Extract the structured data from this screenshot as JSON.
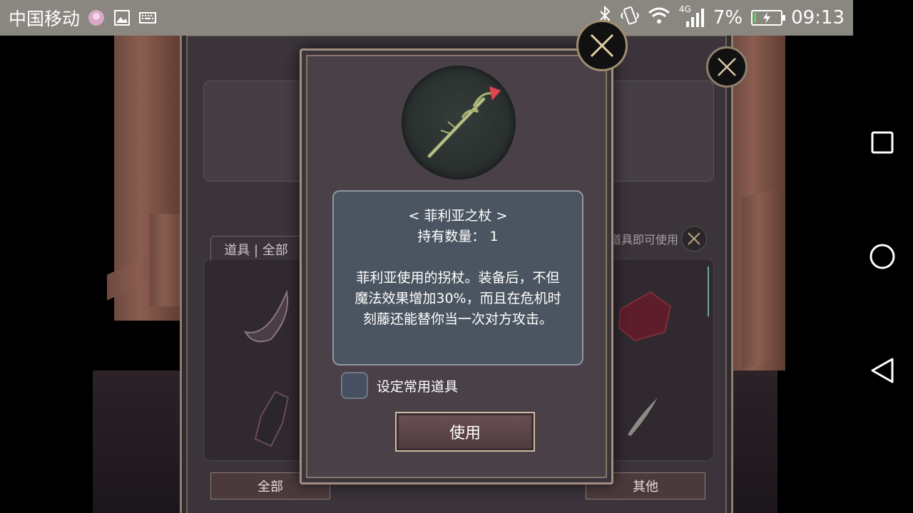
{
  "status_bar": {
    "carrier": "中国移动",
    "network": "4G",
    "battery_percent": "7%",
    "battery_level": 0.07,
    "time": "09:13"
  },
  "inventory": {
    "tab_label": "道具 | 全部",
    "hint_text": "点击道具即可使用",
    "bottom_tabs": [
      "全部",
      "其他"
    ]
  },
  "item_detail": {
    "name": "< 菲利亚之杖 >",
    "quantity_label": "持有数量：",
    "quantity_value": "1",
    "description_lines": [
      "菲利亚使用的拐杖。装备后，不但",
      "魔法效果增加30%，而且在危机时",
      "刻藤还能替你当一次对方攻击。"
    ],
    "favorite_label": "设定常用道具",
    "use_button_label": "使用"
  },
  "colors": {
    "status_bar_bg": "#8a8781",
    "dialog_bg": "#494048",
    "desc_box_bg": "#4b5561",
    "use_button_bg": "#5b4548"
  },
  "icons": [
    "bluetooth-icon",
    "vibrate-icon",
    "wifi-icon",
    "signal-icon",
    "battery-icon",
    "gallery-icon",
    "keyboard-icon",
    "recent-apps-icon",
    "home-icon",
    "back-icon",
    "close-icon",
    "staff-icon"
  ]
}
